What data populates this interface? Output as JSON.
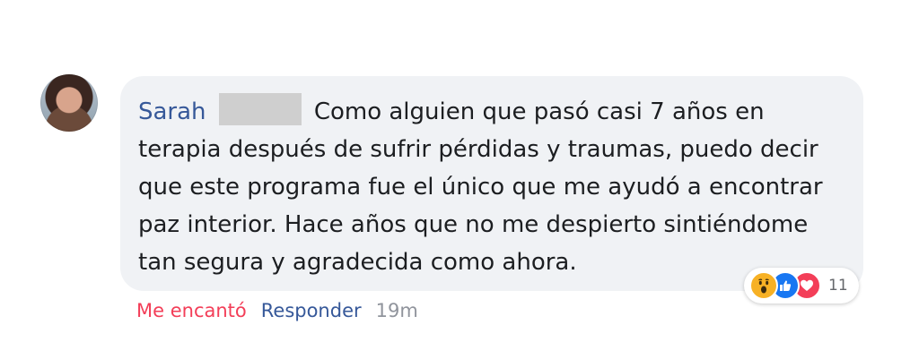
{
  "comment": {
    "author": "Sarah",
    "author_redacted": true,
    "text": "Como alguien que pasó casi 7 años en terapia después de sufrir pérdidas y traumas, puedo decir que este programa fue el único que me ayudó a encontrar paz interior. Hace años que no me despierto sintiéndome tan segura y agradecida como ahora.",
    "reactions": {
      "icons": [
        "wow-icon",
        "like-icon",
        "love-icon"
      ],
      "count": "11"
    },
    "actions": {
      "love_label": "Me encantó",
      "reply_label": "Responder",
      "time": "19m"
    }
  },
  "colors": {
    "bubble": "#f0f2f5",
    "author": "#365899",
    "love": "#f33e58",
    "like": "#1877f2",
    "wow": "#f7b125",
    "muted": "#90949c"
  }
}
